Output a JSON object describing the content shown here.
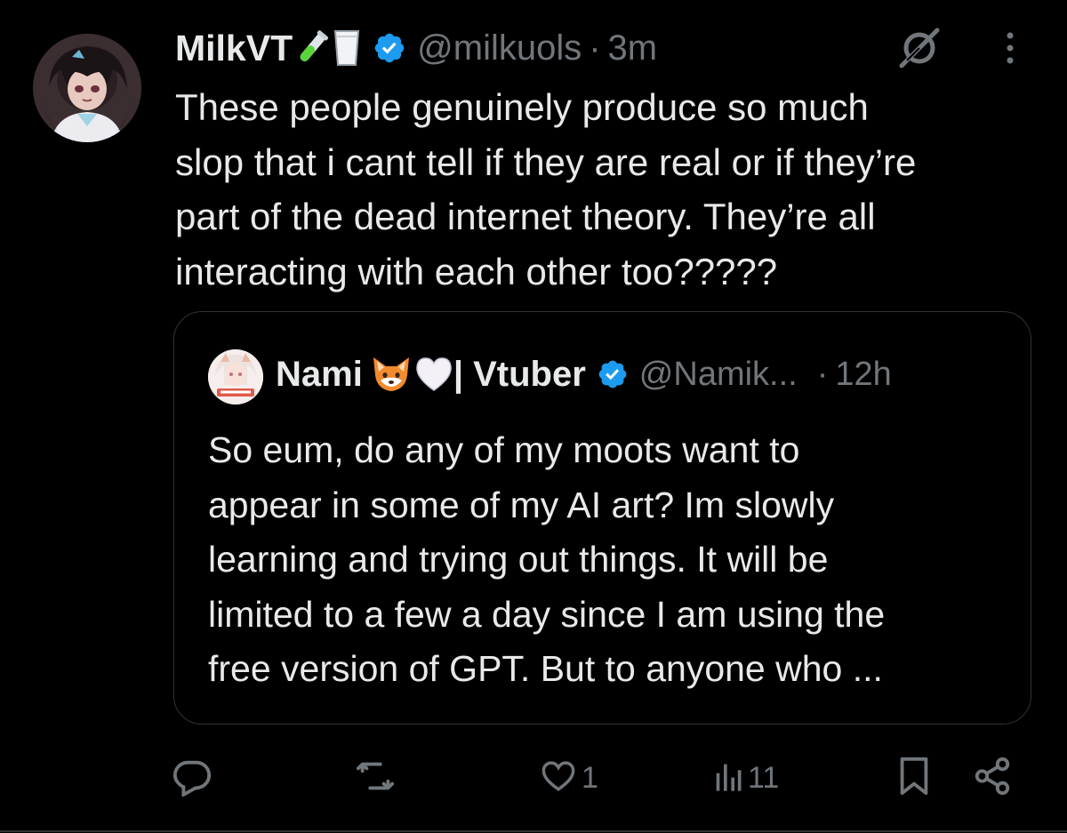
{
  "tweet": {
    "author": {
      "display_name": "MilkVT",
      "name_emojis": [
        "test-tube-emoji",
        "milk-glass-emoji"
      ],
      "verified": true,
      "handle": "@milkuols",
      "time": "3m"
    },
    "separator": "·",
    "text": "These people genuinely produce so much\nslop that i cant tell if they are real or if they’re\npart of the dead internet theory. They’re all\ninteracting with each other too?????"
  },
  "quoted_tweet": {
    "author": {
      "display_name": "Nami",
      "name_emojis": [
        "fox-emoji",
        "white-heart-emoji"
      ],
      "name_suffix": "| Vtuber",
      "verified": true,
      "handle": "@Namik...",
      "time": "12h"
    },
    "separator": "·",
    "text": "So eum, do any of my moots want to\nappear in some of my AI art? Im slowly\nlearning and trying out things. It will be\nlimited to a few a day since I am using the\nfree version of GPT. But to anyone who ..."
  },
  "actions": {
    "reply_count": "",
    "repost_count": "",
    "like_count": "1",
    "views_count": "11"
  },
  "colors": {
    "background": "#000000",
    "text": "#e7e9ea",
    "secondary": "#71767b",
    "border": "#2f3336",
    "verified": "#1d9bf0"
  },
  "icons": [
    "grok-icon",
    "more-icon",
    "reply-icon",
    "repost-icon",
    "like-icon",
    "views-icon",
    "bookmark-icon",
    "share-icon",
    "verified-badge-icon"
  ]
}
